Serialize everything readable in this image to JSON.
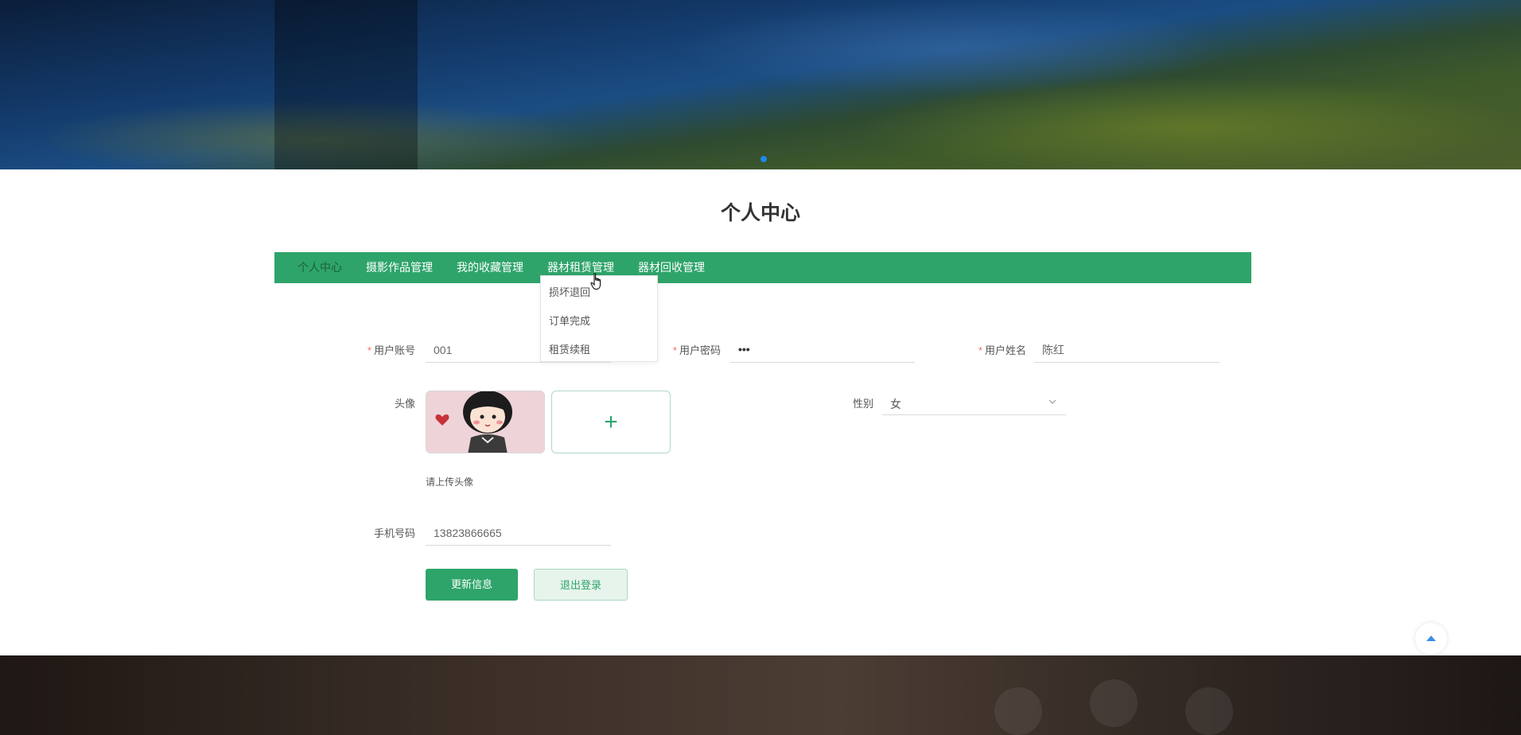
{
  "page": {
    "title": "个人中心"
  },
  "nav": {
    "items": [
      {
        "label": "个人中心",
        "active": true
      },
      {
        "label": "摄影作品管理"
      },
      {
        "label": "我的收藏管理"
      },
      {
        "label": "器材租赁管理"
      },
      {
        "label": "器材回收管理"
      }
    ],
    "dropdown": [
      "损坏退回",
      "订单完成",
      "租赁续租"
    ]
  },
  "form": {
    "account": {
      "label": "用户账号",
      "value": "001",
      "required": true
    },
    "password": {
      "label": "用户密码",
      "value": "•••",
      "required": true
    },
    "name": {
      "label": "用户姓名",
      "value": "陈红",
      "required": true
    },
    "avatar": {
      "label": "头像",
      "hint": "请上传头像"
    },
    "gender": {
      "label": "性别",
      "value": "女"
    },
    "phone": {
      "label": "手机号码",
      "value": "13823866665"
    }
  },
  "buttons": {
    "update": "更新信息",
    "logout": "退出登录"
  },
  "colors": {
    "primary": "#2ea46a",
    "required": "#f56c6c",
    "carousel_dot": "#1e88e5"
  },
  "icons": [
    "plus-icon",
    "chevron-down-icon",
    "arrow-up-icon",
    "pointer-cursor-icon"
  ]
}
